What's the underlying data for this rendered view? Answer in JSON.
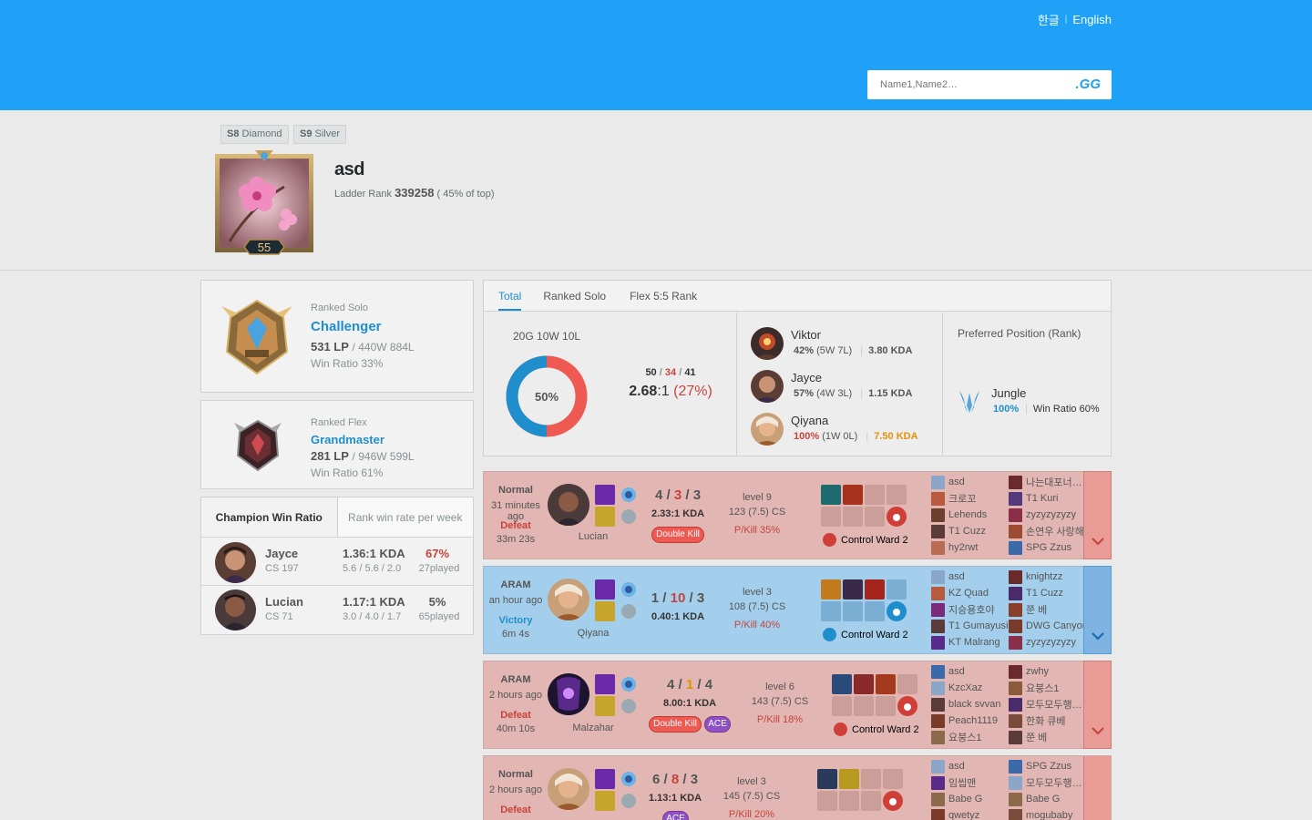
{
  "header": {
    "lang_korean": "한글",
    "lang_english": "English",
    "search_placeholder": "Name1,Name2…",
    "search_button": ".GG"
  },
  "profile": {
    "badges": [
      {
        "season": "S8",
        "tier": "Diamond"
      },
      {
        "season": "S9",
        "tier": "Silver"
      }
    ],
    "level": "55",
    "name": "asd",
    "ladder_label": "Ladder Rank",
    "ladder_rank": "339258",
    "ladder_pct": "( 45% of top)"
  },
  "ranked_solo": {
    "label": "Ranked Solo",
    "tier": "Challenger",
    "lp": "531 LP",
    "record": "/ 440W 884L",
    "win_ratio": "Win Ratio 33%"
  },
  "ranked_flex": {
    "label": "Ranked Flex",
    "tier": "Grandmaster",
    "lp": "281 LP",
    "record": "/ 946W 599L",
    "win_ratio": "Win Ratio 61%"
  },
  "champ_tabs": {
    "tab1": "Champion Win Ratio",
    "tab2": "Rank win rate per week"
  },
  "champ_rows": [
    {
      "name": "Jayce",
      "cs": "CS 197",
      "kda": "1.36:1 KDA",
      "detail": "5.6 / 5.6 / 2.0",
      "winrate": "67%",
      "played": "27played"
    },
    {
      "name": "Lucian",
      "cs": "CS 71",
      "kda": "1.17:1 KDA",
      "detail": "3.0 / 4.0 / 1.7",
      "winrate": "5%",
      "played": "65played"
    }
  ],
  "summary": {
    "tabs": [
      "Total",
      "Ranked Solo",
      "Flex 5:5 Rank"
    ],
    "record": "20G 10W 10L",
    "donut_label": "50%",
    "winrate_fraction": 0.5,
    "kills": "50",
    "deaths": "34",
    "assists": "41",
    "kda_ratio": "2.68",
    "kda_suffix": ":1",
    "kp": "(27%)",
    "champions": [
      {
        "name": "Viktor",
        "wr": "42%",
        "record": "(5W 7L)",
        "kda": "3.80 KDA"
      },
      {
        "name": "Jayce",
        "wr": "57%",
        "record": "(4W 3L)",
        "kda": "1.15 KDA"
      },
      {
        "name": "Qiyana",
        "wr": "100%",
        "record": "(1W 0L)",
        "kda": "7.50 KDA"
      }
    ],
    "position_title": "Preferred Position (Rank)",
    "position_name": "Jungle",
    "position_pct": "100%",
    "position_wr": "Win Ratio 60%"
  },
  "games": [
    {
      "type": "Normal",
      "time": "31 minutes ago",
      "result": "Defeat",
      "length": "33m 23s",
      "champion": "Lucian",
      "k": "4",
      "d": "3",
      "a": "3",
      "kda": "2.33:1 KDA",
      "badges": [
        "Double Kill"
      ],
      "level": "level 9",
      "cs": "123 (7.5) CS",
      "pkill": "P/Kill 35%",
      "ward": "Control Ward 2",
      "team1": [
        "asd",
        "크로꼬",
        "Lehends",
        "T1 Cuzz",
        "hy2rwt"
      ],
      "team2": [
        "나는대포너…",
        "T1 Kuri",
        "zyzyzyzyzy",
        "손연우 사랑해",
        "SPG Zzus"
      ]
    },
    {
      "type": "ARAM",
      "time": "an hour ago",
      "result": "Victory",
      "length": "6m 4s",
      "champion": "Qiyana",
      "k": "1",
      "d": "10",
      "a": "3",
      "kda": "0.40:1 KDA",
      "badges": [],
      "level": "level 3",
      "cs": "108 (7.5) CS",
      "pkill": "P/Kill 40%",
      "ward": "Control Ward 2",
      "team1": [
        "asd",
        "KZ Quad",
        "지승용호야",
        "T1 Gumayusi",
        "KT Malrang"
      ],
      "team2": [
        "knightzz",
        "T1 Cuzz",
        "쭌 베",
        "DWG Canyon",
        "zyzyzyzyzy"
      ]
    },
    {
      "type": "ARAM",
      "time": "2 hours ago",
      "result": "Defeat",
      "length": "40m 10s",
      "champion": "Malzahar",
      "k": "4",
      "d": "1",
      "a": "4",
      "kda": "8.00:1 KDA",
      "badges": [
        "Double Kill",
        "ACE"
      ],
      "level": "level 6",
      "cs": "143 (7.5) CS",
      "pkill": "P/Kill 18%",
      "ward": "Control Ward 2",
      "team1": [
        "asd",
        "KzcXaz",
        "black svvan",
        "Peach1119",
        "요붕스1"
      ],
      "team2": [
        "zwhy",
        "요붕스1",
        "모두모두행…",
        "한화 큐베",
        "쭌 베"
      ]
    },
    {
      "type": "Normal",
      "time": "2 hours ago",
      "result": "Defeat",
      "length": "",
      "champion": "",
      "k": "6",
      "d": "8",
      "a": "3",
      "kda": "1.13:1 KDA",
      "badges": [
        "ACE"
      ],
      "level": "level 3",
      "cs": "145 (7.5) CS",
      "pkill": "P/Kill 20%",
      "ward": "",
      "team1": [
        "asd",
        "임씹맨",
        "Babe G",
        "qwetyz"
      ],
      "team2": [
        "SPG Zzus",
        "모두모두행…",
        "Babe G",
        "mogubaby"
      ]
    }
  ],
  "colors": {
    "header_bg": "#1ea1f7",
    "accent_blue": "#1f8ecd",
    "loss_red": "#c6443e",
    "win_blue": "#1f8ecd",
    "kda_gold": "#e19205"
  }
}
